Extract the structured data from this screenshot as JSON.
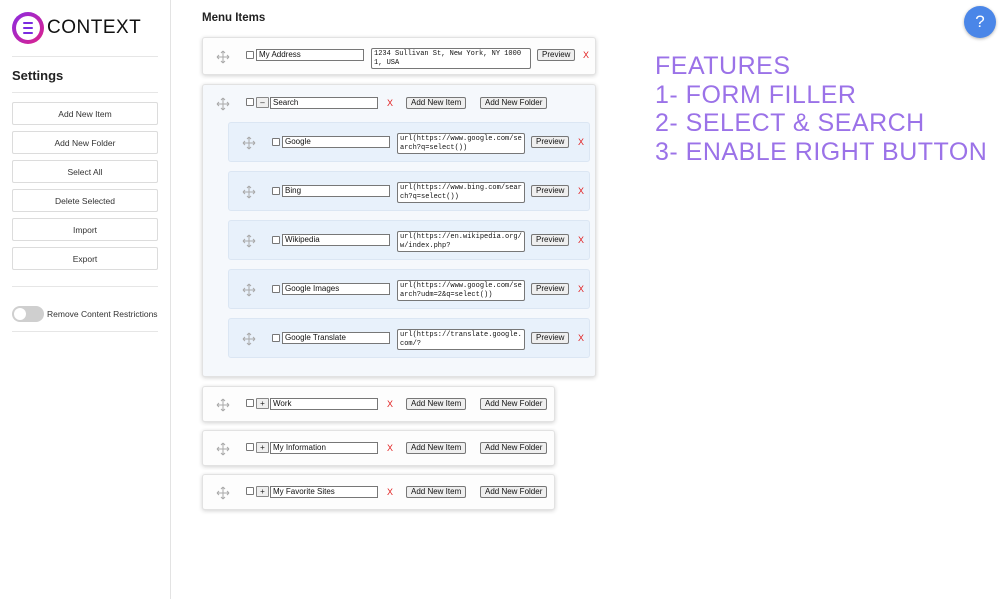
{
  "app": {
    "logo_text": "CONTEXT",
    "brand_colors": {
      "logo_gradient_start": "#8a2be2",
      "logo_gradient_end": "#e0218a",
      "help_button": "#4a86e8",
      "features_text": "#9b72e8",
      "delete_x": "#e22020"
    }
  },
  "sidebar": {
    "title": "Settings",
    "buttons": [
      "Add New Item",
      "Add New Folder",
      "Select All",
      "Delete Selected",
      "Import",
      "Export"
    ],
    "toggle": {
      "label": "Remove Content Restrictions",
      "on": false
    }
  },
  "main": {
    "title": "Menu Items",
    "labels": {
      "preview": "Preview",
      "delete": "X",
      "add_item": "Add New Item",
      "add_folder": "Add New Folder",
      "collapse": "–",
      "expand": "+"
    },
    "items": [
      {
        "type": "item",
        "name": "My Address",
        "value": "1234 Sullivan St, New York, NY 10001, USA"
      },
      {
        "type": "folder",
        "name": "Search",
        "expanded": true,
        "children": [
          {
            "name": "Google",
            "value": "url(https://www.google.com/search?q=select())"
          },
          {
            "name": "Bing",
            "value": "url(https://www.bing.com/search?q=select())"
          },
          {
            "name": "Wikipedia",
            "value": "url(https://en.wikipedia.org/w/index.php?"
          },
          {
            "name": "Google Images",
            "value": "url(https://www.google.com/search?udm=2&q=select())"
          },
          {
            "name": "Google Translate",
            "value": "url(https://translate.google.com/?"
          }
        ]
      },
      {
        "type": "folder",
        "name": "Work",
        "expanded": false
      },
      {
        "type": "folder",
        "name": "My Information",
        "expanded": false
      },
      {
        "type": "folder",
        "name": "My Favorite Sites",
        "expanded": false
      }
    ]
  },
  "features": {
    "lines": [
      "FEATURES",
      "1- FORM FILLER",
      "2- SELECT & SEARCH",
      "3- ENABLE RIGHT BUTTON"
    ]
  },
  "help": {
    "icon": "question-icon",
    "label": "?"
  }
}
